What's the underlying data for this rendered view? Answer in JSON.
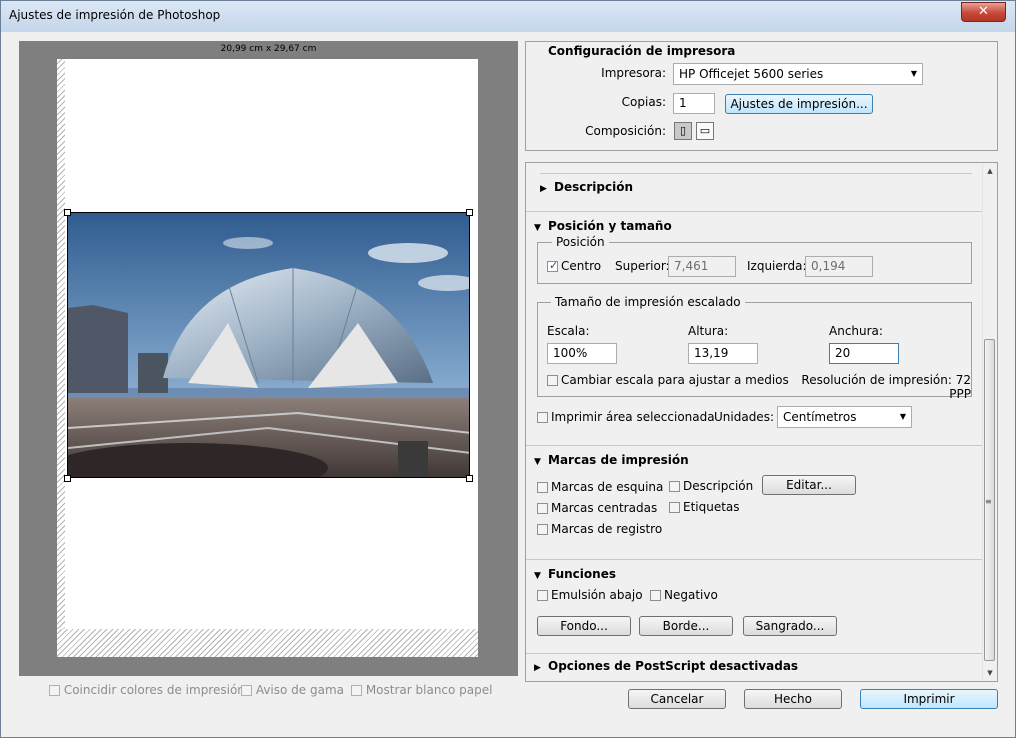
{
  "window": {
    "title": "Ajustes de impresión de Photoshop",
    "close_glyph": "✕"
  },
  "preview": {
    "paper_size": "20,99 cm x 29,67 cm"
  },
  "bottom_checks": [
    {
      "label": "Coincidir colores de impresión"
    },
    {
      "label": "Aviso de gama"
    },
    {
      "label": "Mostrar blanco papel"
    }
  ],
  "printer_config": {
    "title": "Configuración de impresora",
    "printer_label": "Impresora:",
    "printer_value": "HP Officejet 5600 series",
    "copies_label": "Copias:",
    "copies_value": "1",
    "print_settings_button": "Ajustes de impresión...",
    "composition_label": "Composición:"
  },
  "sections": {
    "description": "Descripción",
    "position_size": "Posición y tamaño",
    "print_marks": "Marcas de impresión",
    "functions": "Funciones",
    "postscript": "Opciones de PostScript desactivadas"
  },
  "position": {
    "legend": "Posición",
    "center_label": "Centro",
    "top_label": "Superior:",
    "top_value": "7,461",
    "left_label": "Izquierda:",
    "left_value": "0,194"
  },
  "scaled": {
    "legend": "Tamaño de impresión escalado",
    "scale_label": "Escala:",
    "scale_value": "100%",
    "height_label": "Altura:",
    "height_value": "13,19",
    "width_label": "Anchura:",
    "width_value": "20",
    "fit_media_label": "Cambiar escala para ajustar a medios",
    "resolution": "Resolución de impresión: 72 PPP"
  },
  "print_selected_label": "Imprimir área seleccionada",
  "units_label": "Unidades:",
  "units_value": "Centímetros",
  "marks": {
    "corner": "Marcas de esquina",
    "center": "Marcas centradas",
    "registration": "Marcas de registro",
    "description": "Descripción",
    "labels": "Etiquetas",
    "edit_button": "Editar..."
  },
  "functions": {
    "emulsion": "Emulsión abajo",
    "negative": "Negativo",
    "background_button": "Fondo...",
    "border_button": "Borde...",
    "bleed_button": "Sangrado..."
  },
  "buttons": {
    "cancel": "Cancelar",
    "done": "Hecho",
    "print": "Imprimir"
  },
  "icons": {
    "dropdown": "▼",
    "expand": "▶",
    "collapse": "▼",
    "scroll_up": "▲",
    "scroll_down": "▼",
    "grip": "≡"
  }
}
